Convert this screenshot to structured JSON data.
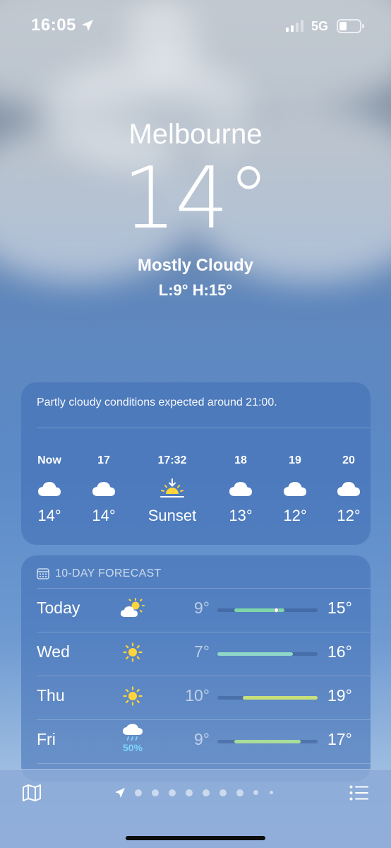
{
  "status_bar": {
    "time": "16:05",
    "network": "5G"
  },
  "location": {
    "city": "Melbourne",
    "temperature": "14°",
    "condition": "Mostly Cloudy",
    "low_high": "L:9° H:15°"
  },
  "hourly": {
    "summary": "Partly cloudy conditions expected around 21:00.",
    "items": [
      {
        "label": "Now",
        "icon": "cloud-icon",
        "value": "14°"
      },
      {
        "label": "17",
        "icon": "cloud-icon",
        "value": "14°"
      },
      {
        "label": "17:32",
        "icon": "sunset-icon",
        "value": "Sunset"
      },
      {
        "label": "18",
        "icon": "cloud-icon",
        "value": "13°"
      },
      {
        "label": "19",
        "icon": "cloud-icon",
        "value": "12°"
      },
      {
        "label": "20",
        "icon": "cloud-icon",
        "value": "12°"
      }
    ]
  },
  "daily": {
    "title": "10-DAY FORECAST",
    "range": [
      7,
      19
    ],
    "days": [
      {
        "day": "Today",
        "icon": "partly-cloudy-icon",
        "low": "9°",
        "high": "15°",
        "low_value": 9,
        "high_value": 15,
        "current_value": 14,
        "fill_color": "#7fd6a8"
      },
      {
        "day": "Wed",
        "icon": "sun-icon",
        "low": "7°",
        "high": "16°",
        "low_value": 7,
        "high_value": 16,
        "fill_color": "#8fd8c8"
      },
      {
        "day": "Thu",
        "icon": "sun-icon",
        "low": "10°",
        "high": "19°",
        "low_value": 10,
        "high_value": 19,
        "fill_color": "#c8e07a"
      },
      {
        "day": "Fri",
        "icon": "rain-cloud-icon",
        "precipitation": "50%",
        "low": "9°",
        "high": "17°",
        "low_value": 9,
        "high_value": 17,
        "fill_color": "#a8dc9a"
      }
    ]
  },
  "colors": {
    "sun": "#ffd43b",
    "precip": "#7fd4ff"
  }
}
